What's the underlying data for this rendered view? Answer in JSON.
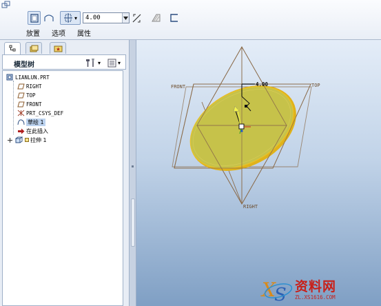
{
  "dashboard": {
    "depth_value": "4.00",
    "tabs": [
      {
        "label": "放置"
      },
      {
        "label": "选项"
      },
      {
        "label": "属性"
      }
    ]
  },
  "navigator": {
    "title": "模型树",
    "tree": [
      {
        "label": "LIANLUN.PRT",
        "icon": "part-icon"
      },
      {
        "label": "RIGHT",
        "icon": "datum-plane-icon"
      },
      {
        "label": "TOP",
        "icon": "datum-plane-icon"
      },
      {
        "label": "FRONT",
        "icon": "datum-plane-icon"
      },
      {
        "label": "PRT_CSYS_DEF",
        "icon": "csys-icon"
      },
      {
        "label": "草绘 1",
        "icon": "sketch-icon"
      },
      {
        "label": "在此插入",
        "icon": "insert-here-arrow-icon"
      },
      {
        "label": "拉伸 1",
        "icon": "extrude-icon"
      }
    ]
  },
  "graphics": {
    "datum_labels": {
      "front": "FRONT",
      "top": "TOP",
      "right": "RIGHT"
    },
    "dimension": "4.00",
    "colors": {
      "extrude_fill": "#c6c24a",
      "extrude_edge": "#e0b21a",
      "datum": "#8b6b4a"
    }
  },
  "watermark": {
    "name": "资料网",
    "url": "ZL.XS1616.COM"
  }
}
